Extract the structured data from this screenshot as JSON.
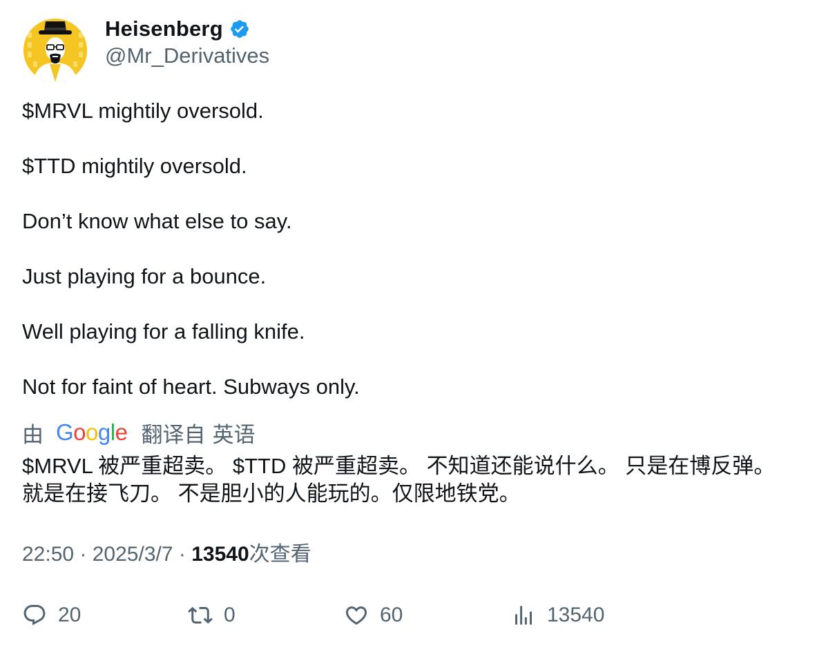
{
  "author": {
    "display_name": "Heisenberg",
    "handle": "@Mr_Derivatives",
    "verified": true,
    "verified_color": "#1d9bf0",
    "avatar_icon": "heisenberg-avatar"
  },
  "tweet": {
    "lines": [
      "$MRVL mightily oversold.",
      "",
      "$TTD mightily oversold.",
      "",
      "Don’t know what else to say.",
      "",
      "Just playing for a bounce.",
      "",
      "Well playing for a falling knife.",
      "",
      "Not for faint of heart. Subways only."
    ]
  },
  "translation": {
    "by_label": "由",
    "provider": "Google",
    "from_label": "翻译自",
    "language": "英语",
    "lines": [
      "$MRVL 被严重超卖。 $TTD 被严重超卖。 不知道还能说什么。 只是在博反弹。",
      "就是在接飞刀。 不是胆小的人能玩的。仅限地铁党。"
    ]
  },
  "meta": {
    "time": "22:50",
    "separator": " · ",
    "date": "2025/3/7",
    "views_count": "13540",
    "views_label": "次查看"
  },
  "actions": {
    "replies": "20",
    "retweets": "0",
    "likes": "60",
    "views": "13540"
  },
  "colors": {
    "text_primary": "#0f1419",
    "text_secondary": "#536471",
    "accent": "#1d9bf0"
  }
}
